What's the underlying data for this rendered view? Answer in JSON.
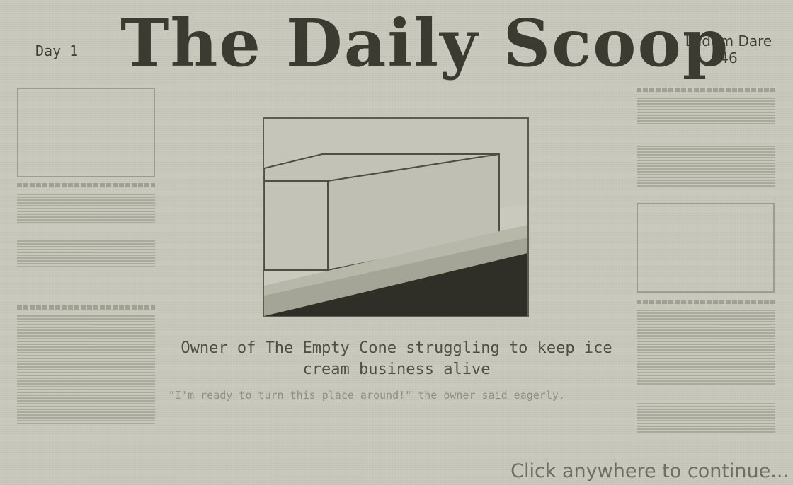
{
  "newspaper": {
    "title": "The Daily Scoop",
    "day": "Day 1",
    "event_line1": "Ludum Dare",
    "event_line2": "46"
  },
  "article": {
    "headline": "Owner of The Empty Cone struggling to keep ice cream business alive",
    "quote": "\"I'm ready to turn this place around!\" the owner said eagerly."
  },
  "prompt": {
    "continue": "Click anywhere to continue..."
  },
  "colors": {
    "paper": "#c8c8bc",
    "ink": "#3b3b31",
    "counter_dark": "#2f2f27",
    "counter_mid": "#a4a497"
  }
}
